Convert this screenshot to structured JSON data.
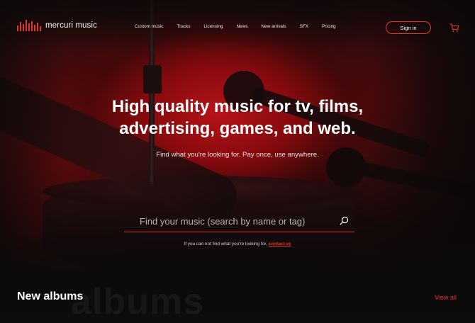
{
  "brand": {
    "name": "mercuri music",
    "logo_icon": "equalizer-bars-icon",
    "accent_color": "#e0362d"
  },
  "nav": {
    "items": [
      "Custom music",
      "Tracks",
      "Licensing",
      "News",
      "New arrivals",
      "SFX",
      "Pricing"
    ]
  },
  "header": {
    "signin_label": "Sign in",
    "cart_icon": "cart-icon"
  },
  "hero": {
    "title_line1": "High quality music for tv, films,",
    "title_line2": "advertising, games, and web.",
    "subtitle": "Find what you're looking for. Pay once, use anywhere."
  },
  "search": {
    "placeholder": "Find your music (search by name or tag)",
    "value": "",
    "icon": "search-icon"
  },
  "help": {
    "text": "If you can not find what you're looking for,",
    "link_label": "contact us"
  },
  "albums": {
    "title": "New albums",
    "ghost_text": "albums",
    "view_all_label": "View all"
  }
}
